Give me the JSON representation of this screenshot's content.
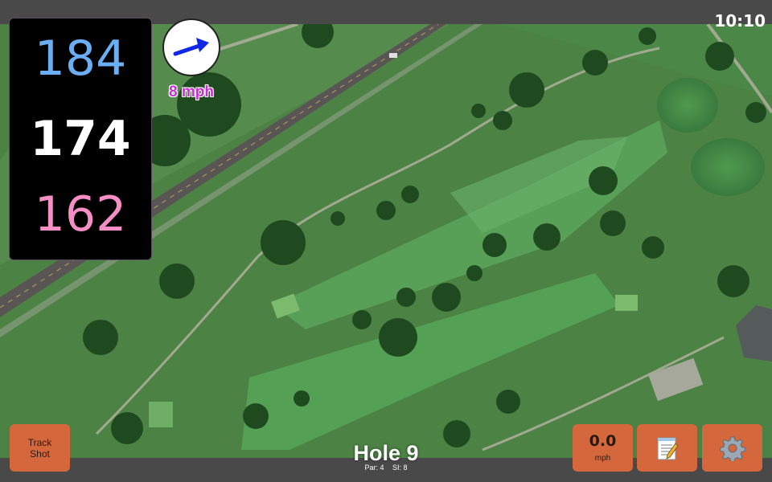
{
  "clock": "10:10",
  "distances": {
    "back": "184",
    "middle": "174",
    "front": "162"
  },
  "wind": {
    "speed_label": "8 mph",
    "direction_icon": "wind-arrow-icon"
  },
  "hole": {
    "title": "Hole 9",
    "par_label": "Par: 4",
    "si_label": "SI: 8"
  },
  "buttons": {
    "track_shot": "Track Shot",
    "speed_value": "0.0",
    "speed_unit": "mph",
    "notes_icon": "notepad-icon",
    "settings_icon": "gear-icon"
  },
  "colors": {
    "back": "#6aaff4",
    "middle": "#ffffff",
    "front": "#f48ec4",
    "wind_text": "#c62fd0",
    "button": "#d4683c",
    "wind_arrow": "#1027e8"
  }
}
